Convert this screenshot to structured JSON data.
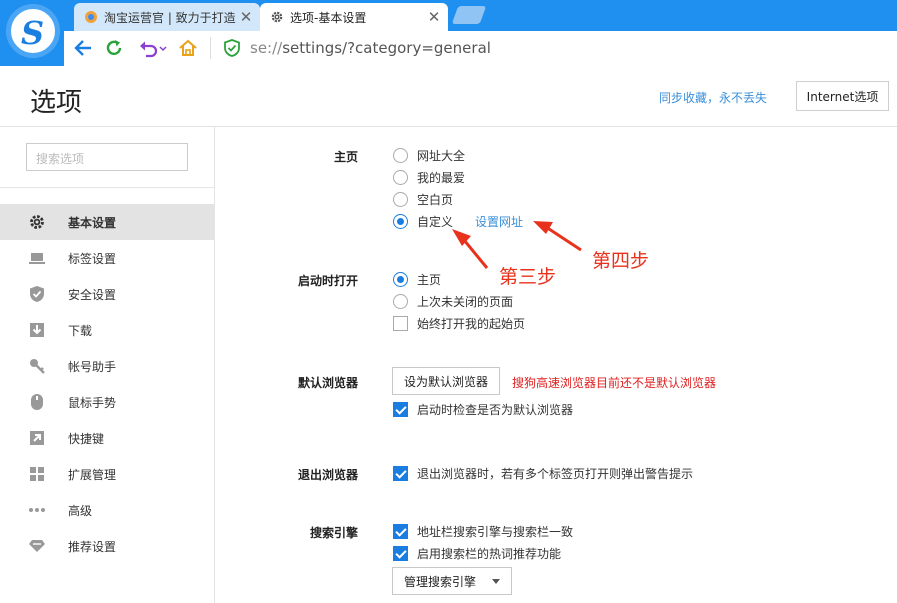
{
  "browser": {
    "tabs": [
      {
        "title": "淘宝运营官 | 致力于打造",
        "active": false
      },
      {
        "title": "选项-基本设置",
        "active": true
      }
    ],
    "url_scheme": "se://",
    "url_rest": "settings/?category=general"
  },
  "header": {
    "title": "选项",
    "sync_link": "同步收藏，永不丢失",
    "ie_button": "Internet选项"
  },
  "sidebar": {
    "search_placeholder": "搜索选项",
    "items": [
      {
        "label": "基本设置",
        "icon": "gear-icon",
        "active": true
      },
      {
        "label": "标签设置",
        "icon": "laptop-icon",
        "active": false
      },
      {
        "label": "安全设置",
        "icon": "shield-icon",
        "active": false
      },
      {
        "label": "下载",
        "icon": "download-icon",
        "active": false
      },
      {
        "label": "帐号助手",
        "icon": "key-icon",
        "active": false
      },
      {
        "label": "鼠标手势",
        "icon": "mouse-icon",
        "active": false
      },
      {
        "label": "快捷键",
        "icon": "shortcut-icon",
        "active": false
      },
      {
        "label": "扩展管理",
        "icon": "extensions-icon",
        "active": false
      },
      {
        "label": "高级",
        "icon": "more-icon",
        "active": false
      },
      {
        "label": "推荐设置",
        "icon": "diamond-icon",
        "active": false
      }
    ]
  },
  "homepage": {
    "label": "主页",
    "options": [
      "网址大全",
      "我的最爱",
      "空白页",
      "自定义"
    ],
    "selected": "自定义",
    "set_url_link": "设置网址"
  },
  "startup": {
    "label": "启动时打开",
    "options": [
      "主页",
      "上次未关闭的页面"
    ],
    "selected": "主页",
    "checkbox": "始终打开我的起始页",
    "checkbox_checked": false
  },
  "default_browser": {
    "label": "默认浏览器",
    "button": "设为默认浏览器",
    "warning": "搜狗高速浏览器目前还不是默认浏览器",
    "checkbox": "启动时检查是否为默认浏览器",
    "checkbox_checked": true
  },
  "exit": {
    "label": "退出浏览器",
    "checkbox": "退出浏览器时，若有多个标签页打开则弹出警告提示",
    "checkbox_checked": true
  },
  "search_engine": {
    "label": "搜索引擎",
    "checkbox1": "地址栏搜索引擎与搜索栏一致",
    "checkbox2": "启用搜索栏的热词推荐功能",
    "manage_button": "管理搜索引擎"
  },
  "annotations": {
    "step3": "第三步",
    "step4": "第四步",
    "color": "#e8321c"
  }
}
